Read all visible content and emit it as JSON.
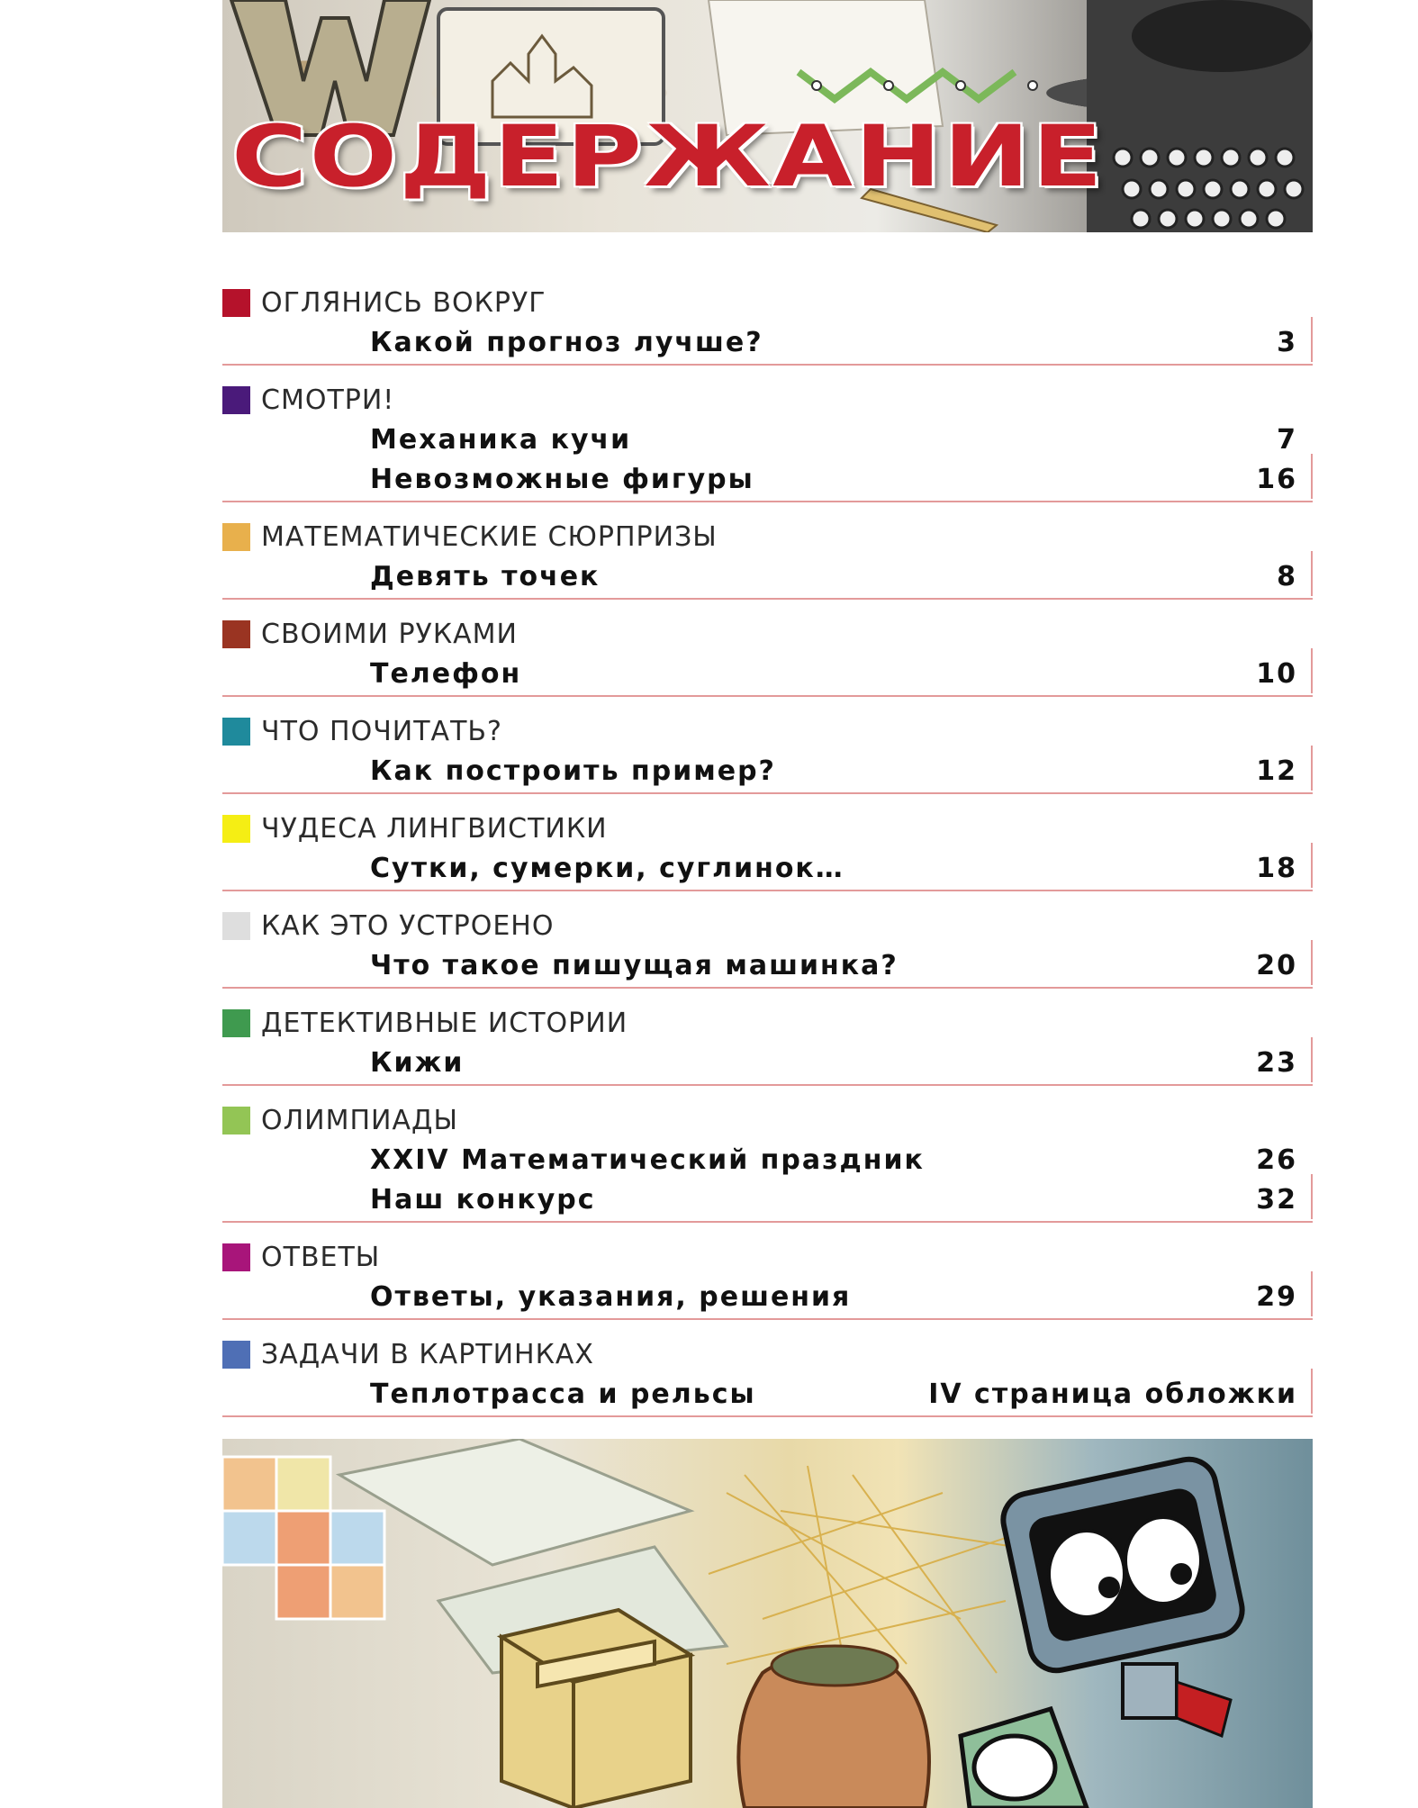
{
  "header": {
    "title": "СОДЕРЖАНИЕ"
  },
  "sections": [
    {
      "title": "ОГЛЯНИСЬ ВОКРУГ",
      "color": "#b5122b",
      "entries": [
        {
          "title": "Какой прогноз лучше?",
          "page": "3"
        }
      ]
    },
    {
      "title": "СМОТРИ!",
      "color": "#4a1a7a",
      "entries": [
        {
          "title": "Механика кучи",
          "page": "7"
        },
        {
          "title": "Невозможные фигуры",
          "page": "16"
        }
      ]
    },
    {
      "title": "МАТЕМАТИЧЕСКИЕ СЮРПРИЗЫ",
      "color": "#e8b04c",
      "entries": [
        {
          "title": "Девять точек",
          "page": "8"
        }
      ]
    },
    {
      "title": "СВОИМИ РУКАМИ",
      "color": "#9a3422",
      "entries": [
        {
          "title": "Телефон",
          "page": "10"
        }
      ]
    },
    {
      "title": "ЧТО ПОЧИТАТЬ?",
      "color": "#1f8a9c",
      "entries": [
        {
          "title": "Как построить пример?",
          "page": "12"
        }
      ]
    },
    {
      "title": "ЧУДЕСА ЛИНГВИСТИКИ",
      "color": "#f5ee14",
      "entries": [
        {
          "title": "Сутки, сумерки, суглинок…",
          "page": "18"
        }
      ]
    },
    {
      "title": "КАК ЭТО УСТРОЕНО",
      "color": "#dedede",
      "entries": [
        {
          "title": "Что такое пишущая машинка?",
          "page": "20"
        }
      ]
    },
    {
      "title": "ДЕТЕКТИВНЫЕ ИСТОРИИ",
      "color": "#3f9a4f",
      "entries": [
        {
          "title": "Кижи",
          "page": "23"
        }
      ]
    },
    {
      "title": "ОЛИМПИАДЫ",
      "color": "#93c555",
      "entries": [
        {
          "title": "XXIV Математический праздник",
          "page": "26"
        },
        {
          "title": "Наш конкурс",
          "page": "32"
        }
      ]
    },
    {
      "title": "ОТВЕТЫ",
      "color": "#a8157a",
      "entries": [
        {
          "title": "Ответы, указания, решения",
          "page": "29"
        }
      ]
    },
    {
      "title": "ЗАДАЧИ В КАРТИНКАХ",
      "color": "#4f6fb5",
      "entries": [
        {
          "title": "Теплотрасса и рельсы",
          "page": "IV страница обложки"
        }
      ]
    }
  ]
}
